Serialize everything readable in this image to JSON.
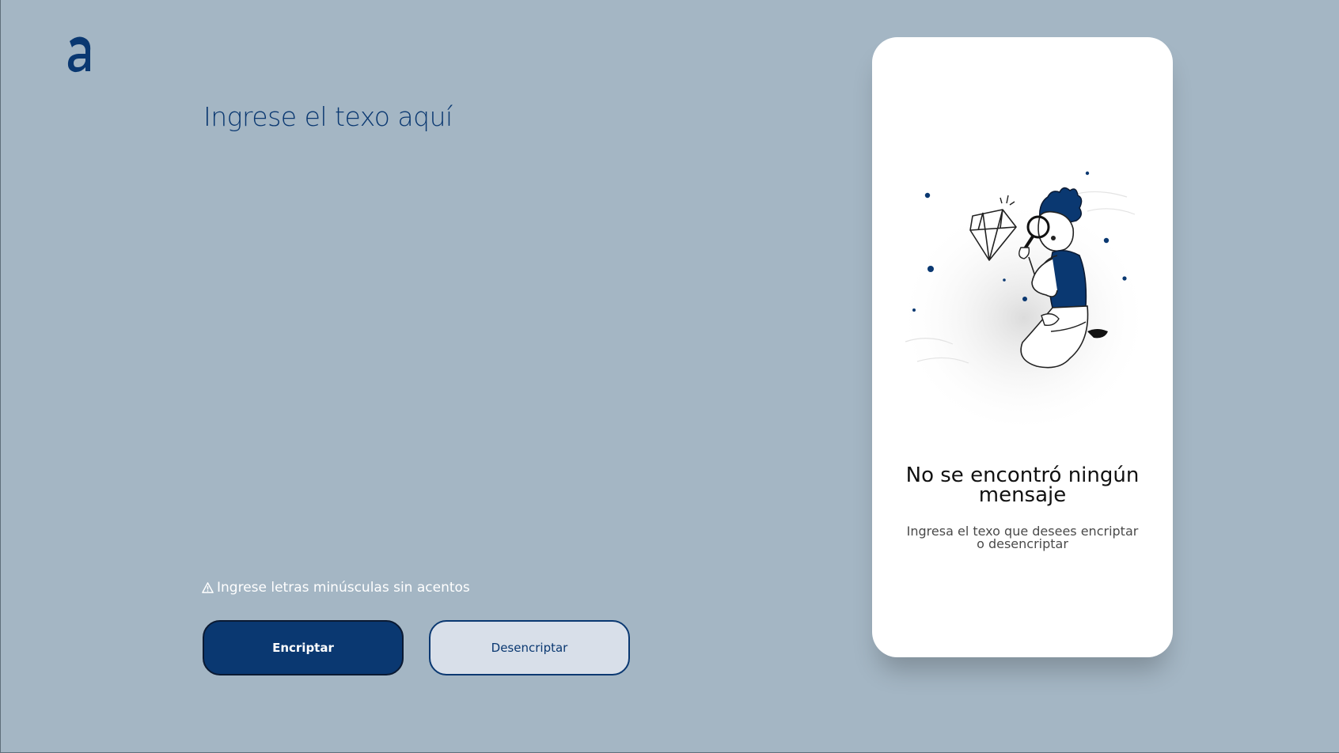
{
  "logo": {
    "icon": "alura-a-logo-icon",
    "color": "#0a3871"
  },
  "input": {
    "placeholder": "Ingrese el texo aquí",
    "value": ""
  },
  "hint": {
    "icon": "warning-icon",
    "text": "Ingrese letras minúsculas sin acentos"
  },
  "buttons": {
    "encrypt": "Encriptar",
    "decrypt": "Desencriptar"
  },
  "output": {
    "illustration": "person-with-magnifier-and-diamond-illustration",
    "title": "No se encontró ningún mensaje",
    "description": "Ingresa el texo que desees encriptar o desencriptar"
  },
  "colors": {
    "background": "#a4b6c4",
    "accent": "#0a3871",
    "panel": "#ffffff"
  }
}
